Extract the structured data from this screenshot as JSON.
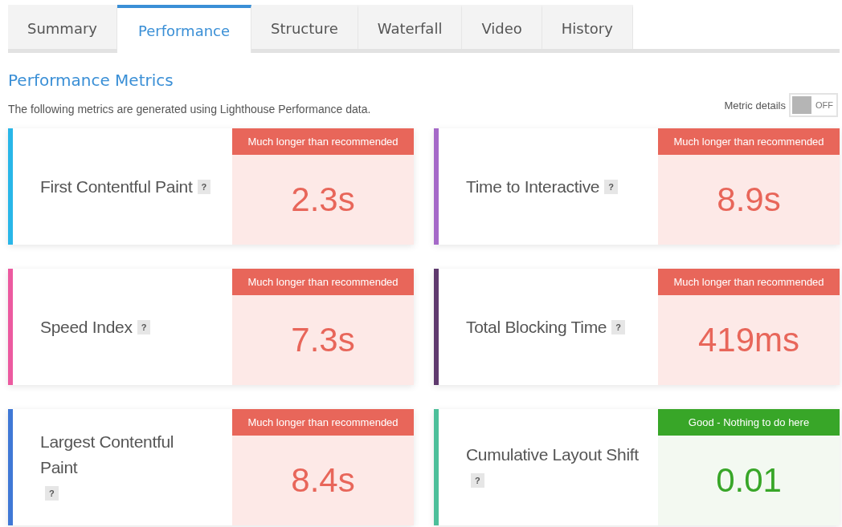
{
  "tabs": [
    {
      "label": "Summary",
      "selected": false
    },
    {
      "label": "Performance",
      "selected": true
    },
    {
      "label": "Structure",
      "selected": false
    },
    {
      "label": "Waterfall",
      "selected": false
    },
    {
      "label": "Video",
      "selected": false
    },
    {
      "label": "History",
      "selected": false
    }
  ],
  "heading": "Performance Metrics",
  "description": "The following metrics are generated using Lighthouse Performance data.",
  "metric_details": {
    "label": "Metric details",
    "on": false,
    "state_text": "OFF"
  },
  "metrics": [
    {
      "name": "First Contentful Paint",
      "help": "?",
      "color": "#29b6e8",
      "kind": "bad",
      "status": "Much longer than recommended",
      "value": "2.3s"
    },
    {
      "name": "Time to Interactive",
      "help": "?",
      "color": "#a569c8",
      "kind": "bad",
      "status": "Much longer than recommended",
      "value": "8.9s"
    },
    {
      "name": "Speed Index",
      "help": "?",
      "color": "#ec5aa0",
      "kind": "bad",
      "status": "Much longer than recommended",
      "value": "7.3s"
    },
    {
      "name": "Total Blocking Time",
      "help": "?",
      "color": "#5f3a6e",
      "kind": "bad",
      "status": "Much longer than recommended",
      "value": "419ms"
    },
    {
      "name": "Largest Contentful Paint",
      "help": "?",
      "color": "#3f78d6",
      "kind": "bad",
      "status": "Much longer than recommended",
      "value": "8.4s"
    },
    {
      "name": "Cumulative Layout Shift",
      "help": "?",
      "color": "#4cbf9a",
      "kind": "good",
      "status": "Good - Nothing to do here",
      "value": "0.01"
    }
  ]
}
